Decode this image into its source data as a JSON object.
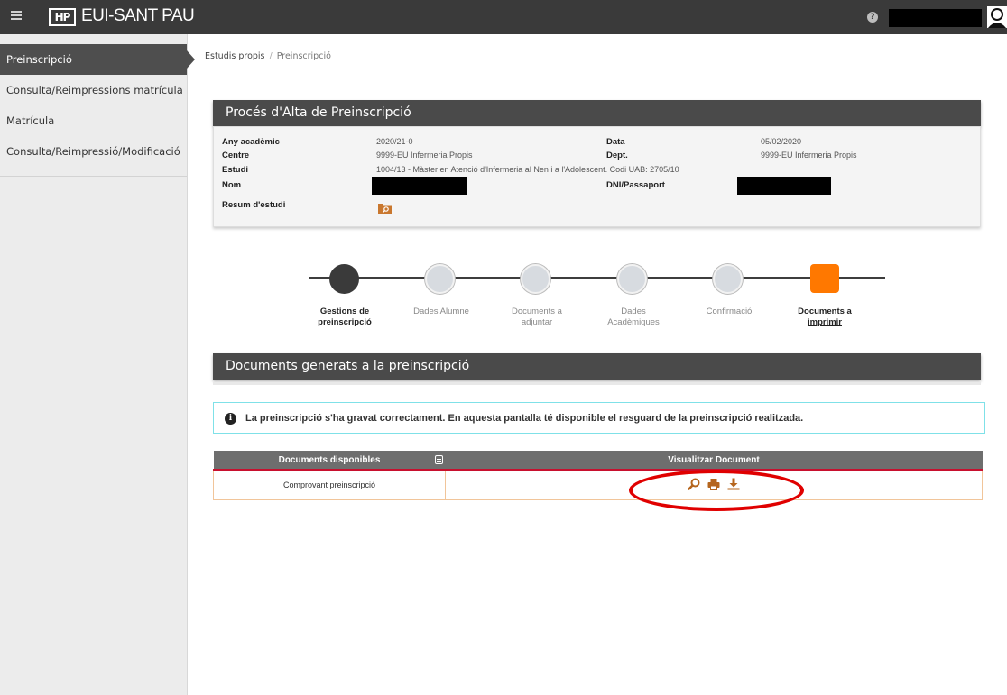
{
  "header": {
    "logo_mark": "HP",
    "brand": "EUI-SANT PAU",
    "help_glyph": "?"
  },
  "sidebar": {
    "items": [
      {
        "label": "Preinscripció",
        "active": true
      },
      {
        "label": "Consulta/Reimpressions matrícula",
        "active": false
      },
      {
        "label": "Matrícula",
        "active": false
      },
      {
        "label": "Consulta/Reimpressió/Modificació",
        "active": false
      }
    ]
  },
  "breadcrumb": {
    "root": "Estudis propis",
    "separator": "/",
    "current": "Preinscripció"
  },
  "process_panel": {
    "title": "Procés d'Alta de Preinscripció",
    "fields": {
      "any_label": "Any acadèmic",
      "any_value": "2020/21-0",
      "data_label": "Data",
      "data_value": "05/02/2020",
      "centre_label": "Centre",
      "centre_value": "9999-EU Infermeria Propis",
      "dept_label": "Dept.",
      "dept_value": "9999-EU Infermeria Propis",
      "estudi_label": "Estudi",
      "estudi_value": "1004/13 - Màster en Atenció d'Infermeria al Nen i a l'Adolescent. Codi UAB: 2705/10",
      "nom_label": "Nom",
      "dni_label": "DNI/Passaport",
      "resum_label": "Resum d'estudi"
    }
  },
  "stepper": {
    "steps": [
      {
        "label_line1": "Gestions de",
        "label_line2": "preinscripció",
        "state": "done"
      },
      {
        "label_line1": "Dades Alumne",
        "label_line2": "",
        "state": "pending"
      },
      {
        "label_line1": "Documents a",
        "label_line2": "adjuntar",
        "state": "pending"
      },
      {
        "label_line1": "Dades",
        "label_line2": "Acadèmiques",
        "state": "pending"
      },
      {
        "label_line1": "Confirmació",
        "label_line2": "",
        "state": "pending"
      },
      {
        "label_line1": "Documents a",
        "label_line2": "imprimir",
        "state": "current"
      }
    ],
    "colors": {
      "done": "#3a3a3a",
      "pending": "#d7dbe0",
      "current": "#ff7800"
    }
  },
  "documents_panel": {
    "title": "Documents generats a la preinscripció"
  },
  "alert": {
    "icon": "i",
    "text": "La preinscripció s'ha gravat correctament. En aquesta pantalla té disponible el resguard de la preinscripció realitzada."
  },
  "doc_table": {
    "columns": [
      "Documents disponibles",
      "Visualitzar Document"
    ],
    "rows": [
      {
        "name": "Comprovant preinscripció",
        "actions": [
          "search-icon",
          "print-icon",
          "download-icon"
        ]
      }
    ]
  },
  "colors": {
    "topbar": "#3a3a3a",
    "accent": "#ff7800",
    "icon_brown": "#b5651d",
    "highlight": "#e00000"
  }
}
